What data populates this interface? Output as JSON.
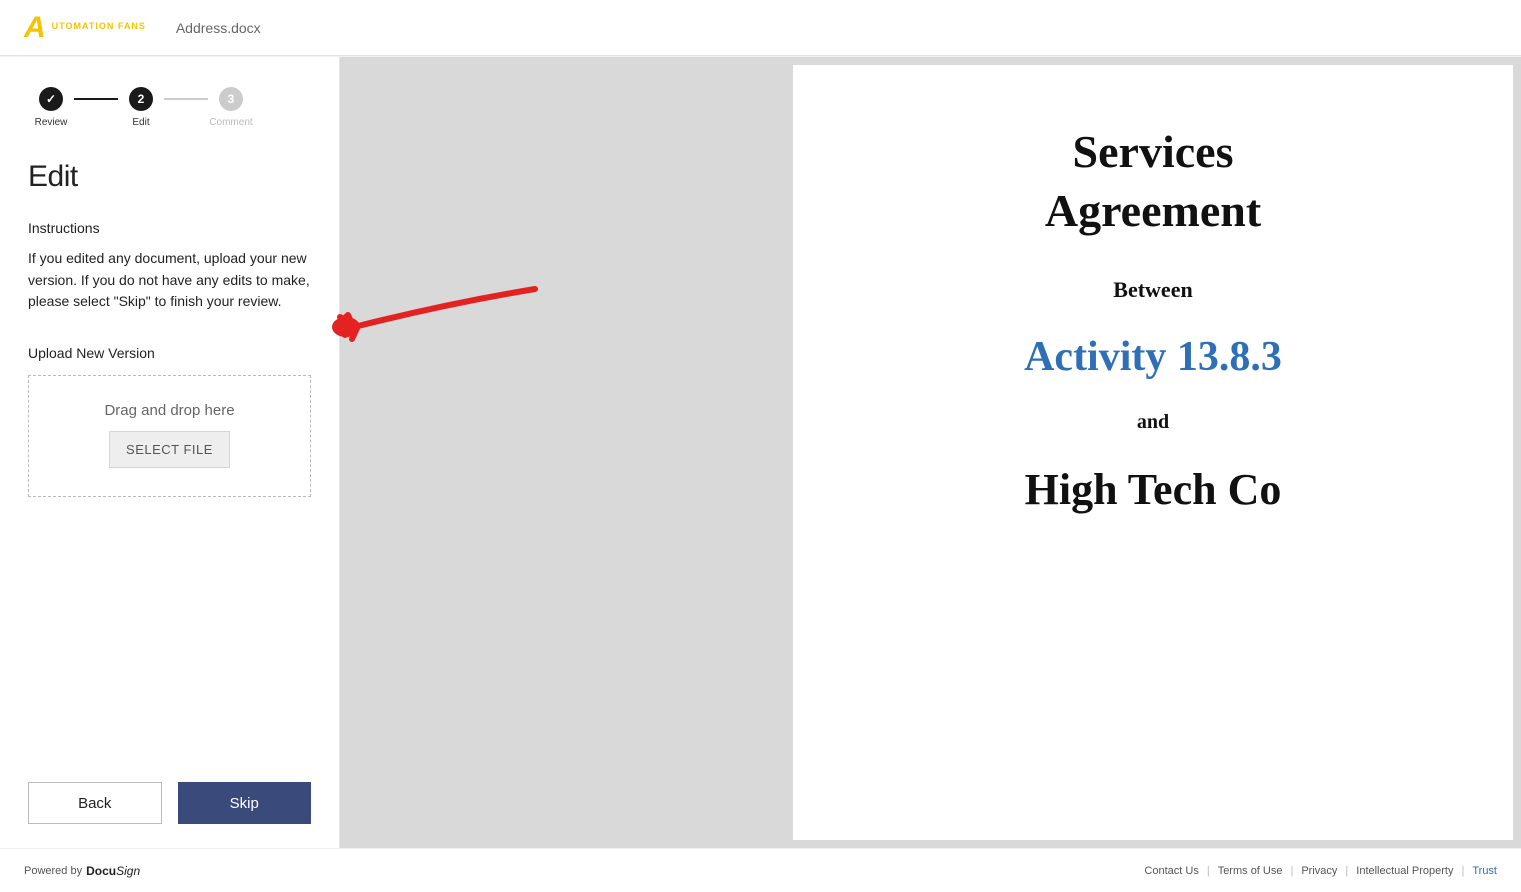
{
  "header": {
    "brand_main": "UTOMATION FANS",
    "brand_sub": "",
    "document_name": "Address.docx"
  },
  "stepper": {
    "steps": [
      {
        "label": "Review",
        "num": "✓"
      },
      {
        "label": "Edit",
        "num": "2"
      },
      {
        "label": "Comment",
        "num": "3"
      }
    ]
  },
  "panel": {
    "title": "Edit",
    "instructions_heading": "Instructions",
    "instructions_text": "If you edited any document, upload your new version. If you do not have any edits to make, please select \"Skip\" to finish your review.",
    "upload_heading": "Upload New Version",
    "dropzone_text": "Drag and drop here",
    "select_file_label": "SELECT FILE",
    "back_label": "Back",
    "skip_label": "Skip"
  },
  "document": {
    "line1": "Services",
    "line2": "Agreement",
    "between": "Between",
    "party1": "Activity 13.8.3",
    "and": "and",
    "party2": "High Tech Co"
  },
  "footer": {
    "powered_prefix": "Powered by ",
    "docu": "Docu",
    "sign": "Sign",
    "links": {
      "contact": "Contact Us",
      "terms": "Terms of Use",
      "privacy": "Privacy",
      "ip": "Intellectual Property",
      "trust": "Trust"
    }
  }
}
